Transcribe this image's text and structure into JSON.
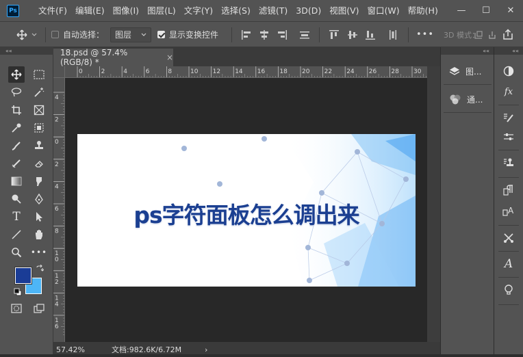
{
  "app": {
    "logo_text": "Ps"
  },
  "menu": [
    "文件(F)",
    "编辑(E)",
    "图像(I)",
    "图层(L)",
    "文字(Y)",
    "选择(S)",
    "滤镜(T)",
    "3D(D)",
    "视图(V)",
    "窗口(W)",
    "帮助(H)"
  ],
  "window_controls": {
    "minimize": "—",
    "maximize": "☐",
    "close": "✕"
  },
  "options_bar": {
    "auto_select_label": "自动选择：",
    "auto_select_checked": false,
    "layer_dropdown_value": "图层",
    "show_transform_label": "显示变换控件",
    "show_transform_checked": true,
    "more_label": "•••",
    "mode_3d_label": "3D 模式："
  },
  "document": {
    "tab_title": "18.psd @ 57.4%(RGB/8) *",
    "tab_close": "×",
    "ruler_top_labels": [
      "0",
      "2",
      "4",
      "6",
      "8",
      "10",
      "12",
      "14",
      "16",
      "18",
      "20",
      "22",
      "24",
      "26",
      "28",
      "30"
    ],
    "ruler_left_labels": [
      "4",
      "2",
      "0",
      "2",
      "4",
      "6",
      "8",
      "1\n0",
      "1\n2",
      "1\n4",
      "1\n6"
    ],
    "image_title": "ps字符面板怎么调出来",
    "colors": {
      "title": "#1b3f91",
      "accent": "#31a8ff",
      "node": "#9fb3d6"
    }
  },
  "status": {
    "zoom": "57.42%",
    "doc_info": "文档:982.6K/6.72M",
    "arrow": "›"
  },
  "panels": {
    "layers_label": "图...",
    "channels_label": "通..."
  },
  "colors": {
    "foreground": "#1a3c96",
    "background": "#4db6f7"
  }
}
